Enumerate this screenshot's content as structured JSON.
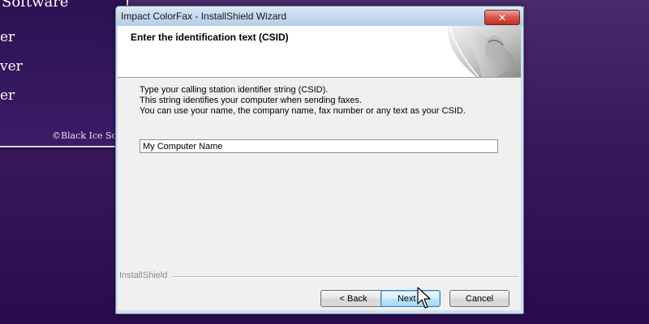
{
  "background": {
    "title": "Software",
    "menu_items": [
      "er",
      "ver",
      "er"
    ],
    "copyright": "©Black Ice Softw"
  },
  "dialog": {
    "title": "Impact ColorFax - InstallShield Wizard",
    "close_glyph": "✕",
    "header": "Enter the identification text (CSID)",
    "instructions": [
      "Type your calling station identifier string (CSID).",
      "This string identifies your computer when sending faxes.",
      "You can use your name, the company name, fax number or any text as your CSID."
    ],
    "csid_value": "My Computer Name",
    "brand": "InstallShield",
    "buttons": {
      "back": "< Back",
      "next": "Next >",
      "cancel": "Cancel"
    }
  },
  "icons": [
    "close-icon",
    "header-artwork",
    "mouse-pointer-icon"
  ],
  "colors": {
    "desktop": "#3a1a5c",
    "titlebar": "#c5d8ee",
    "close_button": "#c1311f",
    "default_button_border": "#3c7fb1"
  }
}
